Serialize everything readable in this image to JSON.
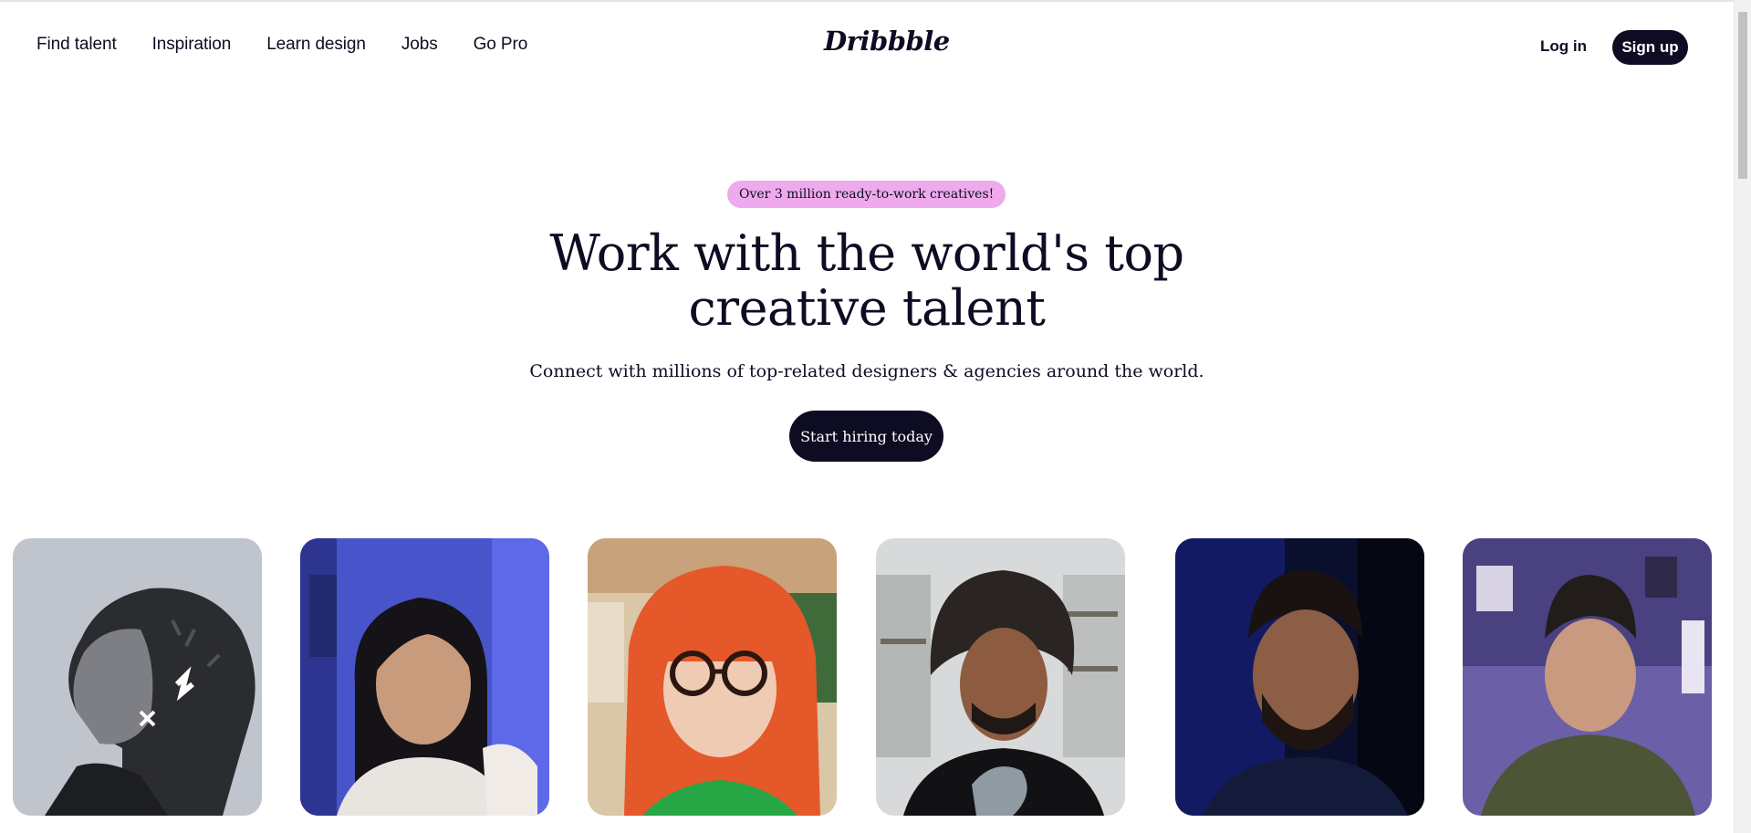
{
  "nav": {
    "items": [
      "Find talent",
      "Inspiration",
      "Learn design",
      "Jobs",
      "Go Pro"
    ]
  },
  "logo": {
    "text": "Dribbble"
  },
  "auth": {
    "login_label": "Log in",
    "signup_label": "Sign up"
  },
  "hero": {
    "badge": "Over 3 million ready-to-work creatives!",
    "title_line1": "Work with the world's top",
    "title_line2": "creative talent",
    "subtitle": "Connect with millions of top-related designers & agencies around the world.",
    "cta_label": "Start hiring today"
  },
  "colors": {
    "ink": "#0d0c22",
    "badge_bg": "#eeaaec",
    "page_bg": "#ffffff"
  },
  "cards": [
    {
      "subject": "man-profile-portrait",
      "tone": "grayscale"
    },
    {
      "subject": "woman-dark-hair-blue-wall",
      "tone": "blue"
    },
    {
      "subject": "woman-red-hair-glasses",
      "tone": "warm"
    },
    {
      "subject": "man-curly-hair-shelves",
      "tone": "neutral"
    },
    {
      "subject": "man-beard-dark-blue",
      "tone": "dark-blue"
    },
    {
      "subject": "man-olive-shirt-purple-room",
      "tone": "purple"
    }
  ]
}
